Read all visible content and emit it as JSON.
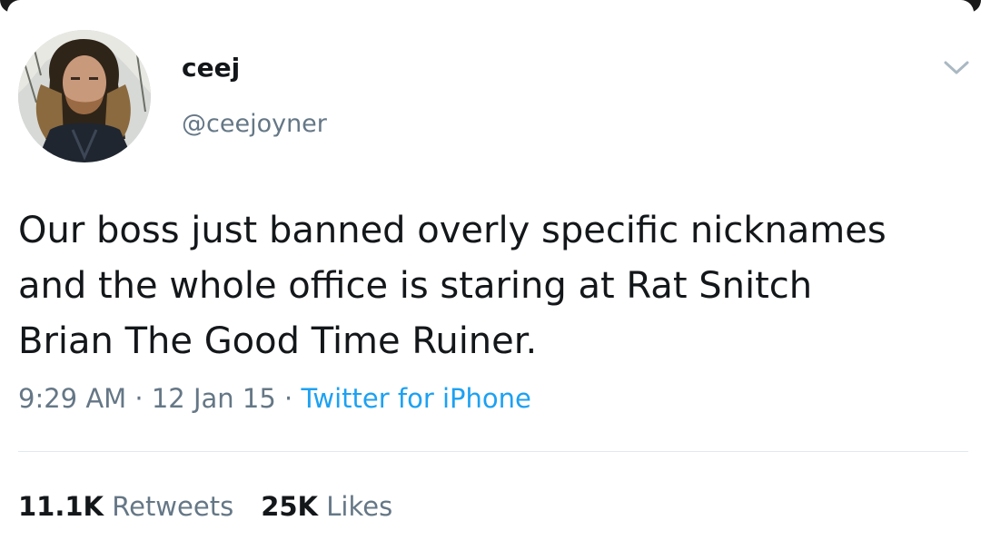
{
  "tweet": {
    "user": {
      "display_name": "ceej",
      "handle": "@ceejoyner"
    },
    "text_lines": [
      "Our boss just banned overly specific nicknames",
      "and the whole office is staring at Rat Snitch",
      "Brian The Good Time Ruiner."
    ],
    "meta": {
      "time": "9:29 AM",
      "separator": "·",
      "date": "12 Jan 15",
      "source": "Twitter for iPhone"
    },
    "stats": {
      "retweets_count": "11.1K",
      "retweets_label": "Retweets",
      "likes_count": "25K",
      "likes_label": "Likes"
    }
  },
  "icons": {
    "menu": "chevron-down-icon"
  },
  "colors": {
    "text_primary": "#14171a",
    "text_secondary": "#657786",
    "link": "#1da1f2",
    "divider": "#e1e8ed"
  }
}
